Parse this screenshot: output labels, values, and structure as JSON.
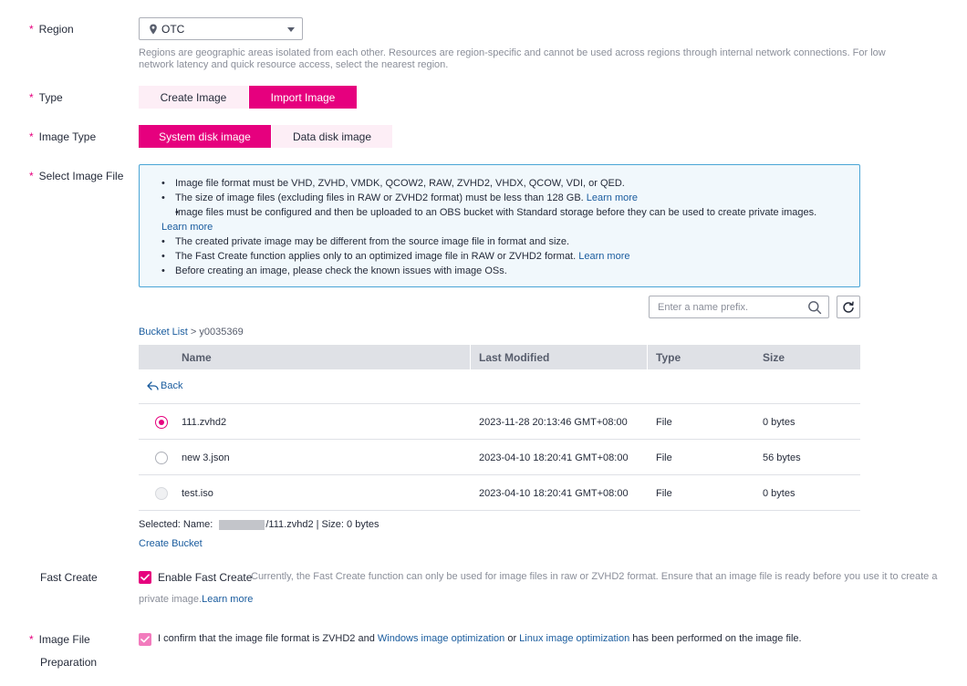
{
  "colors": {
    "accent": "#e6007e",
    "link": "#1a5c9e",
    "info_border": "#4aa5d6",
    "info_bg": "#f1f8fc"
  },
  "region": {
    "label": "Region",
    "value": "OTC",
    "hint": "Regions are geographic areas isolated from each other. Resources are region-specific and cannot be used across regions through internal network connections. For low network latency and quick resource access, select the nearest region."
  },
  "type": {
    "label": "Type",
    "options": [
      "Create Image",
      "Import Image"
    ],
    "selected": "Import Image"
  },
  "image_type": {
    "label": "Image Type",
    "options": [
      "System disk image",
      "Data disk image"
    ],
    "selected": "System disk image"
  },
  "select_file": {
    "label": "Select Image File",
    "info": [
      {
        "text": "Image file format must be VHD, ZVHD, VMDK, QCOW2, RAW, ZVHD2, VHDX, QCOW, VDI, or QED.",
        "link": ""
      },
      {
        "text": "The size of image files (excluding files in RAW or ZVHD2 format) must be less than 128 GB. ",
        "link": "Learn more"
      },
      {
        "text": "Image files must be configured and then be uploaded to an OBS bucket with Standard storage before they can be used to create private images. ",
        "link": "Learn more"
      },
      {
        "text": "The created private image may be different from the source image file in format and size.",
        "link": ""
      },
      {
        "text": "The Fast Create function applies only to an optimized image file in RAW or ZVHD2 format. ",
        "link": "Learn more"
      },
      {
        "text": "Before creating an image, please check the known issues with image OSs.",
        "link": ""
      }
    ],
    "search_placeholder": "Enter a name prefix.",
    "breadcrumb": {
      "link": "Bucket List",
      "sep": " > ",
      "current": "y0035369"
    },
    "columns": [
      "Name",
      "Last Modified",
      "Type",
      "Size"
    ],
    "back_label": "Back",
    "rows": [
      {
        "name": "111.zvhd2",
        "modified": "2023-11-28 20:13:46 GMT+08:00",
        "type": "File",
        "size": "0 bytes",
        "state": "selected"
      },
      {
        "name": "new 3.json",
        "modified": "2023-04-10 18:20:41 GMT+08:00",
        "type": "File",
        "size": "56 bytes",
        "state": "normal"
      },
      {
        "name": "test.iso",
        "modified": "2023-04-10 18:20:41 GMT+08:00",
        "type": "File",
        "size": "0 bytes",
        "state": "disabled"
      }
    ],
    "selected_prefix": "Selected: Name: ",
    "selected_suffix": "/111.zvhd2 | Size: 0 bytes",
    "create_bucket": "Create Bucket"
  },
  "fast_create": {
    "label": "Fast Create",
    "checkbox_label": "Enable Fast Create",
    "note_line1": "Currently, the Fast Create function can only be used for image files in raw or ZVHD2 format. Ensure that an image file is ready before you use it to create a",
    "note_line2": "private image.",
    "learn_more": "Learn more"
  },
  "preparation": {
    "label_line1": "Image File",
    "label_line2": "Preparation",
    "text1": "I confirm that the image file format is ZVHD2 and ",
    "link1": "Windows image optimization",
    "text2": " or ",
    "link2": "Linux image optimization",
    "text3": " has been performed on the image file."
  }
}
